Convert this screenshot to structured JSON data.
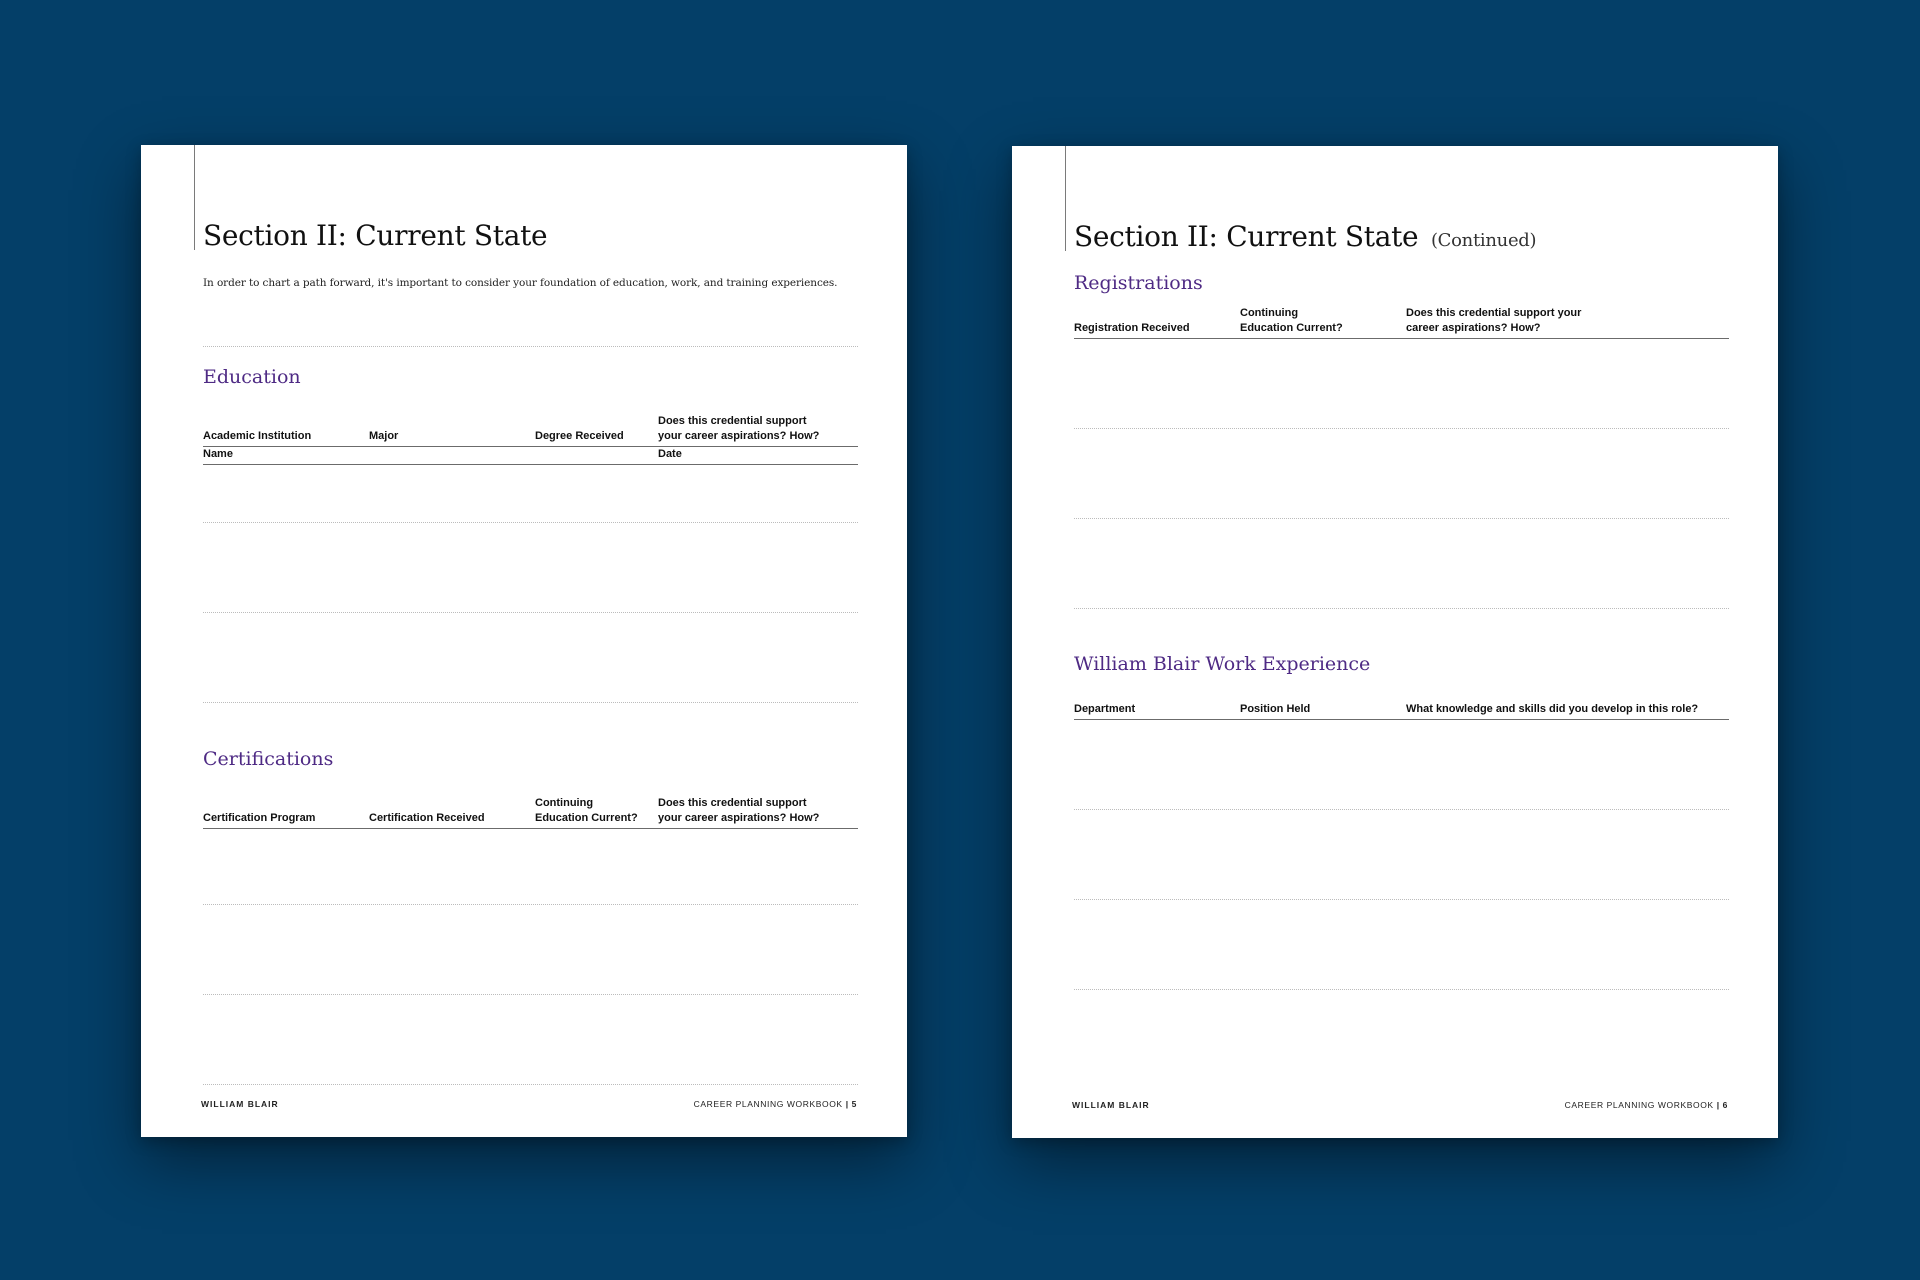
{
  "pages": [
    {
      "title": "Section II: Current State",
      "intro": "In order to chart a path forward, it's important to consider your foundation of education, work, and training experiences.",
      "name_row": {
        "name_label": "Name",
        "date_label": "Date"
      },
      "education": {
        "heading": "Education",
        "columns": [
          "Academic Institution",
          "Major",
          "Degree Received",
          "Does this credential support\nyour career aspirations? How?"
        ]
      },
      "certifications": {
        "heading": "Certifications",
        "columns": [
          "Certification Program",
          "Certification Received",
          "Continuing\nEducation Current?",
          "Does this credential support\nyour career aspirations? How?"
        ]
      },
      "footer": {
        "brand": "WILLIAM BLAIR",
        "label": "CAREER PLANNING WORKBOOK",
        "separator": "|",
        "page_number": "5"
      }
    },
    {
      "title": "Section II: Current State",
      "title_suffix": "(Continued)",
      "registrations": {
        "heading": "Registrations",
        "columns": [
          "Registration Received",
          "Continuing\nEducation Current?",
          "Does this credential support your\ncareer aspirations? How?"
        ]
      },
      "work_experience": {
        "heading": "William Blair Work Experience",
        "columns": [
          "Department",
          "Position Held",
          "What knowledge and skills did you develop in this role?"
        ]
      },
      "footer": {
        "brand": "WILLIAM BLAIR",
        "label": "CAREER PLANNING WORKBOOK",
        "separator": "|",
        "page_number": "6"
      }
    }
  ]
}
